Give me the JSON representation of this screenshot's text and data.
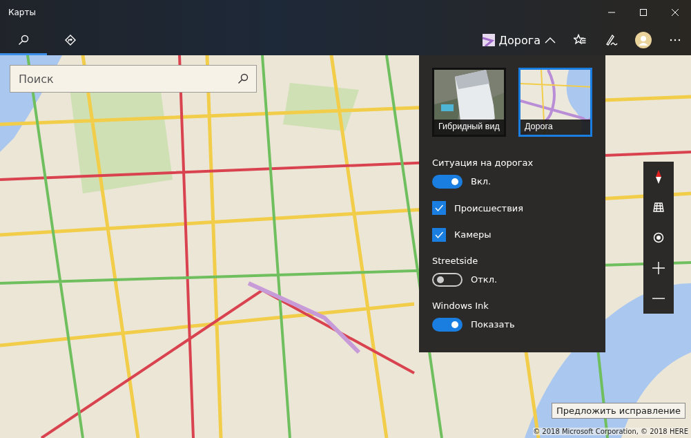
{
  "window": {
    "title": "Карты"
  },
  "nav": [
    {
      "kind": "search",
      "selected": true
    },
    {
      "kind": "directions",
      "selected": false
    }
  ],
  "map_style_button": {
    "label": "Дорога",
    "expanded": true
  },
  "search": {
    "placeholder": "Поиск"
  },
  "flyout": {
    "styles": [
      {
        "kind": "hybrid",
        "label": "Гибридный вид",
        "selected": false
      },
      {
        "kind": "road",
        "label": "Дорога",
        "selected": true
      }
    ],
    "settings": [
      {
        "kind": "heading",
        "label": "Ситуация на дорогах"
      },
      {
        "kind": "toggle",
        "label": "Вкл.",
        "on": true
      },
      {
        "kind": "checkbox",
        "label": "Происшествия",
        "checked": true
      },
      {
        "kind": "checkbox",
        "label": "Камеры",
        "checked": true
      },
      {
        "kind": "heading",
        "label": "Streetside"
      },
      {
        "kind": "toggle",
        "label": "Откл.",
        "on": false
      },
      {
        "kind": "heading",
        "label": "Windows Ink"
      },
      {
        "kind": "toggle",
        "label": "Показать",
        "on": true
      }
    ]
  },
  "suggest_button": "Предложить исправление",
  "copyright": "© 2018 Microsoft Corporation, © 2018 HERE"
}
